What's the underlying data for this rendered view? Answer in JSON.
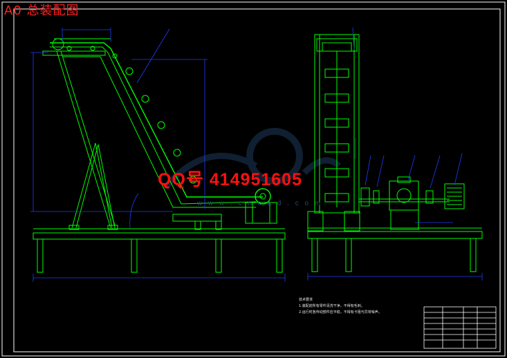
{
  "drawing": {
    "title": "A0 总装配图",
    "qq_watermark": "QQ号 414951605",
    "site_watermark": "w w w . c n c a d . c o m"
  },
  "colors": {
    "background": "#000000",
    "frame": "#ffffff",
    "outline": "#00ff00",
    "dimension": "#1f3cff",
    "title_text": "#ff2020",
    "watermark": "#1e3a5a"
  },
  "technical_requirements": {
    "heading": "技术要求",
    "items": [
      "1.装配前所有零件清洗干净，不得有毛刺。",
      "2.运行时各传动部件应平稳，不得有卡阻与异常噪声。"
    ]
  }
}
